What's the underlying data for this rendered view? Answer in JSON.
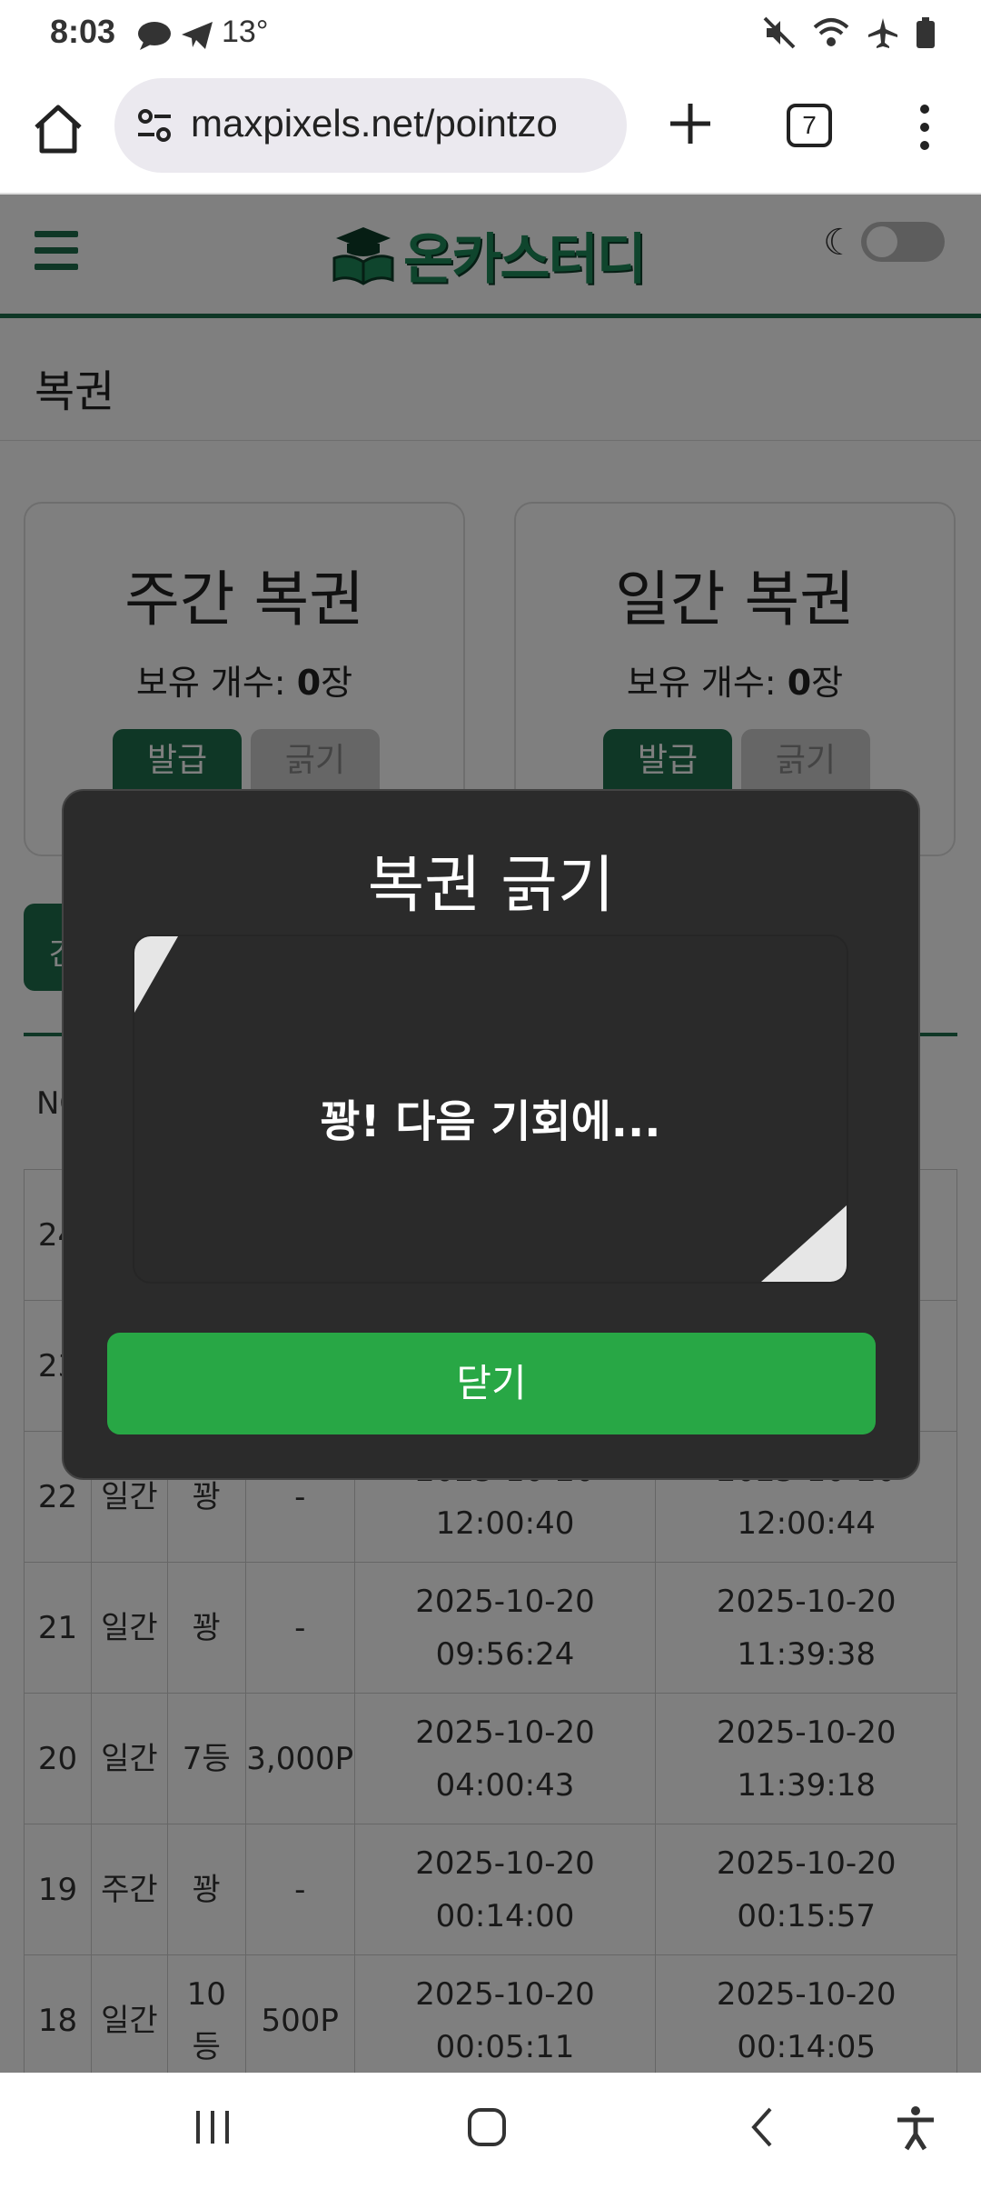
{
  "status_bar": {
    "time": "8:03",
    "temperature": "13°",
    "icons_left": [
      "chat-icon",
      "telegram-icon"
    ],
    "icons_right": [
      "mute-icon",
      "wifi-icon",
      "airplane-icon",
      "battery-icon"
    ]
  },
  "browser": {
    "url": "maxpixels.net/pointzo",
    "tab_count": "7"
  },
  "site": {
    "logo_text": "온카스터디"
  },
  "page": {
    "title": "복권"
  },
  "cards": [
    {
      "title": "주간 복권",
      "count_label": "보유 개수: ",
      "count_value": "0",
      "count_unit": "장",
      "issue_label": "발급",
      "scratch_label": "긁기"
    },
    {
      "title": "일간 복권",
      "count_label": "보유 개수: ",
      "count_value": "0",
      "count_unit": "장",
      "issue_label": "발급",
      "scratch_label": "긁기"
    }
  ],
  "filter": {
    "label": "간"
  },
  "table": {
    "no_header": "NO",
    "rows": [
      {
        "no": "24",
        "type": "",
        "result": "",
        "prize": "",
        "issued": "",
        "scratched": ""
      },
      {
        "no": "23",
        "type": "",
        "result": "",
        "prize": "",
        "issued": "",
        "scratched": ""
      },
      {
        "no": "22",
        "type": "일간",
        "result": "꽝",
        "prize": "-",
        "issued": "2025-10-20 12:00:40",
        "scratched": "2025-10-20 12:00:44"
      },
      {
        "no": "21",
        "type": "일간",
        "result": "꽝",
        "prize": "-",
        "issued": "2025-10-20 09:56:24",
        "scratched": "2025-10-20 11:39:38"
      },
      {
        "no": "20",
        "type": "일간",
        "result": "7등",
        "prize": "3,000P",
        "issued": "2025-10-20 04:00:43",
        "scratched": "2025-10-20 11:39:18"
      },
      {
        "no": "19",
        "type": "주간",
        "result": "꽝",
        "prize": "-",
        "issued": "2025-10-20 00:14:00",
        "scratched": "2025-10-20 00:15:57"
      },
      {
        "no": "18",
        "type": "일간",
        "result": "10등",
        "prize": "500P",
        "issued": "2025-10-20 00:05:11",
        "scratched": "2025-10-20 00:14:05"
      }
    ]
  },
  "modal": {
    "title": "복권 긁기",
    "result_text": "꽝! 다음 기회에...",
    "close_label": "닫기"
  },
  "colors": {
    "brand_green": "#1f6e4d",
    "close_button": "#28a745",
    "modal_bg": "#2b2b2b"
  }
}
